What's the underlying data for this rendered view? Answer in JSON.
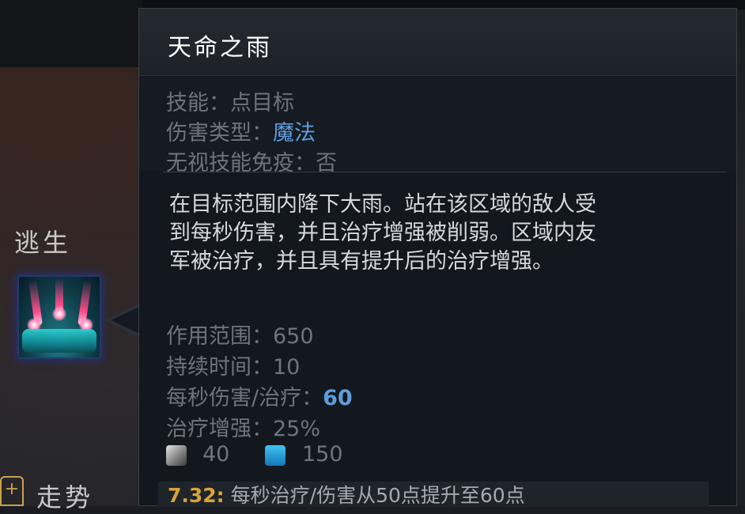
{
  "left_panel": {
    "section_escape": "逃生",
    "section_momentum": "走势",
    "ability_icon": "rain-ability-icon",
    "plus_icon_glyph": "+"
  },
  "tooltip": {
    "title": "天命之雨",
    "attributes": [
      {
        "label": "技能：",
        "value": "点目标"
      },
      {
        "label": "伤害类型：",
        "value": "魔法"
      },
      {
        "label": "无视技能免疫：",
        "value": "否"
      }
    ],
    "description_lines": [
      "在目标范围内降下大雨。站在该区域的敌人受",
      "到每秒伤害，并且治疗增强被削弱。区域内友",
      "军被治疗，并且具有提升后的治疗增强。"
    ],
    "stats": [
      {
        "label": "作用范围：",
        "value": "650"
      },
      {
        "label": "持续时间：",
        "value": "10"
      },
      {
        "label": "每秒伤害/治疗：",
        "value": "60"
      },
      {
        "label": "治疗增强：",
        "value": "25%"
      }
    ],
    "cooldown": "40",
    "mana_cost": "150",
    "patch_version": "7.32:",
    "patch_note": "每秒治疗/伤害从50点提升至60点"
  },
  "colors": {
    "magic_blue": "#5e9ddc",
    "label_gray": "#6e747c",
    "patch_gold": "#d8a534"
  }
}
